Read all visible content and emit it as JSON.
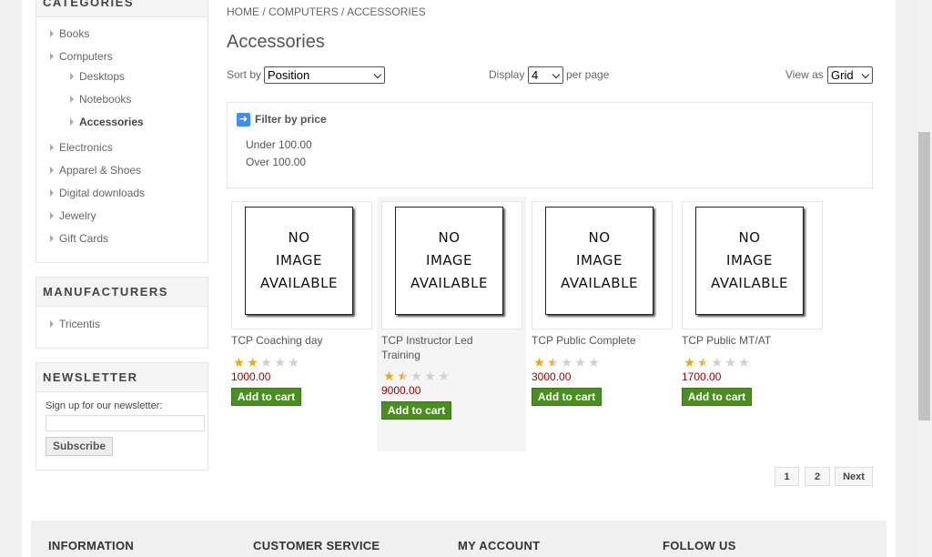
{
  "sidebar": {
    "categories_title": "CATEGORIES",
    "categories": [
      {
        "label": "Books"
      },
      {
        "label": "Computers"
      },
      {
        "label": "Desktops"
      },
      {
        "label": "Notebooks"
      },
      {
        "label": "Accessories"
      },
      {
        "label": "Electronics"
      },
      {
        "label": "Apparel & Shoes"
      },
      {
        "label": "Digital downloads"
      },
      {
        "label": "Jewelry"
      },
      {
        "label": "Gift Cards"
      }
    ],
    "manufacturers_title": "MANUFACTURERS",
    "manufacturers": [
      {
        "label": "Tricentis"
      }
    ],
    "newsletter_title": "NEWSLETTER",
    "newsletter_label": "Sign up for our newsletter:",
    "newsletter_input_value": "",
    "subscribe_label": "Subscribe"
  },
  "breadcrumb": {
    "home": "HOME",
    "sep": "/",
    "computers": "COMPUTERS",
    "current": "ACCESSORIES"
  },
  "page_title": "Accessories",
  "controls": {
    "sort_label": "Sort by",
    "sort_value": "Position",
    "display_label": "Display",
    "display_value": "4",
    "per_page_label": "per page",
    "view_label": "View as",
    "view_value": "Grid"
  },
  "filter": {
    "title": "Filter by price",
    "icon": "arrow-right-icon",
    "options": [
      "Under 100.00",
      "Over 100.00"
    ]
  },
  "no_image_text": [
    "NO",
    "IMAGE",
    "AVAILABLE"
  ],
  "products": [
    {
      "title": "TCP Coaching day",
      "rating": 2,
      "price": "1000.00",
      "cart": "Add to cart"
    },
    {
      "title": "TCP Instructor Led Training",
      "rating": 1.5,
      "price": "9000.00",
      "cart": "Add to cart"
    },
    {
      "title": "TCP Public Complete",
      "rating": 1.5,
      "price": "3000.00",
      "cart": "Add to cart"
    },
    {
      "title": "TCP Public MT/AT",
      "rating": 1.5,
      "price": "1700.00",
      "cart": "Add to cart"
    }
  ],
  "pager": {
    "page1": "1",
    "page2": "2",
    "next": "Next"
  },
  "footer": {
    "information": "INFORMATION",
    "customer_service": "CUSTOMER SERVICE",
    "my_account": "MY ACCOUNT",
    "follow_us": "FOLLOW US"
  },
  "colors": {
    "price": "#990000",
    "cart_button": "#4a8e1f",
    "star": "#f0a800",
    "filter_icon": "#3d8ff0"
  }
}
